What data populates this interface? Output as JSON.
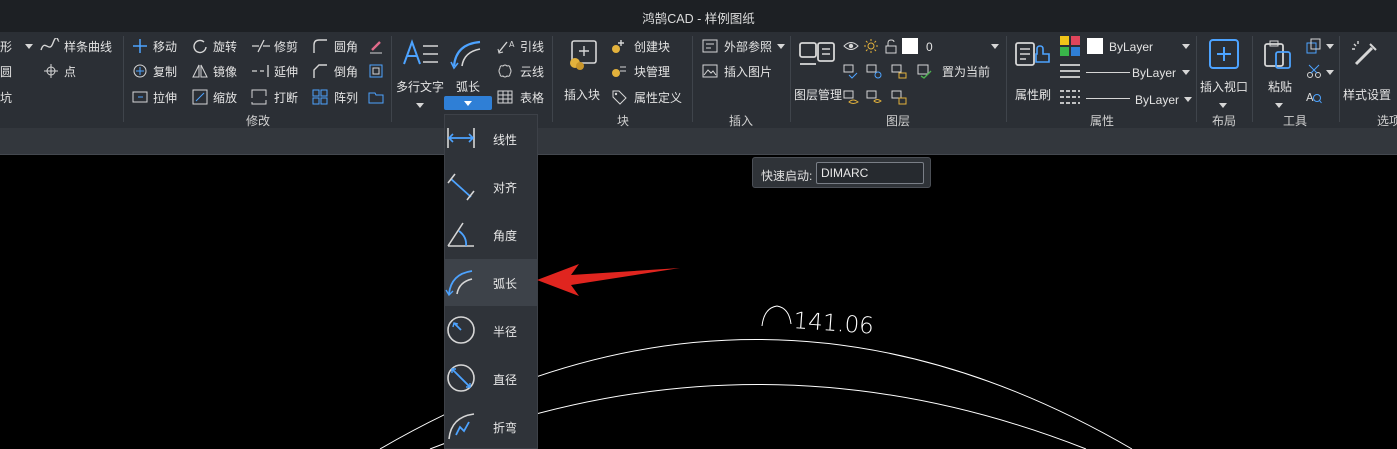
{
  "title": "鸿鹄CAD - 样例图纸",
  "ribbon": {
    "left_partial": [
      "形",
      "圆",
      "坑"
    ],
    "draw": {
      "spline": "样条曲线",
      "point": "点"
    },
    "modify": {
      "group_label": "修改",
      "items": [
        "移动",
        "旋转",
        "修剪",
        "圆角",
        "复制",
        "镜像",
        "延伸",
        "倒角",
        "拉伸",
        "缩放",
        "打断",
        "阵列"
      ]
    },
    "annotation": {
      "mtext": "多行文字",
      "dim": "弧长",
      "leader": "引线",
      "cloud": "云线",
      "table": "表格"
    },
    "block": {
      "group_label": "块",
      "insert": "插入块",
      "create": "创建块",
      "manage": "块管理",
      "attdef": "属性定义"
    },
    "insert": {
      "group_label": "插入",
      "xref": "外部参照",
      "image": "插入图片"
    },
    "layer": {
      "group_label": "图层",
      "manager": "图层管理",
      "current_layer": "0",
      "set_current": "置为当前"
    },
    "properties": {
      "group_label": "属性",
      "match": "属性刷",
      "color": "ByLayer",
      "linetype": "ByLayer",
      "lineweight": "ByLayer"
    },
    "layout": {
      "group_label": "布局",
      "viewport": "插入视口"
    },
    "tools": {
      "group_label": "工具",
      "paste": "粘贴"
    },
    "style": {
      "settings": "样式设置",
      "group_label_partial": "选项"
    }
  },
  "dim_menu": [
    {
      "label": "线性",
      "icon": "linear-dim-icon"
    },
    {
      "label": "对齐",
      "icon": "aligned-dim-icon"
    },
    {
      "label": "角度",
      "icon": "angular-dim-icon"
    },
    {
      "label": "弧长",
      "icon": "arc-length-dim-icon"
    },
    {
      "label": "半径",
      "icon": "radius-dim-icon"
    },
    {
      "label": "直径",
      "icon": "diameter-dim-icon"
    },
    {
      "label": "折弯",
      "icon": "jogged-dim-icon"
    }
  ],
  "quick_launch": {
    "label": "快速启动:",
    "value": "DIMARC"
  },
  "drawing": {
    "dimension_text": "141.06"
  },
  "colors": {
    "accent": "#2f7fd6",
    "annotation_arrow": "#e0251f",
    "ribbon_bg": "#2b2f35"
  }
}
